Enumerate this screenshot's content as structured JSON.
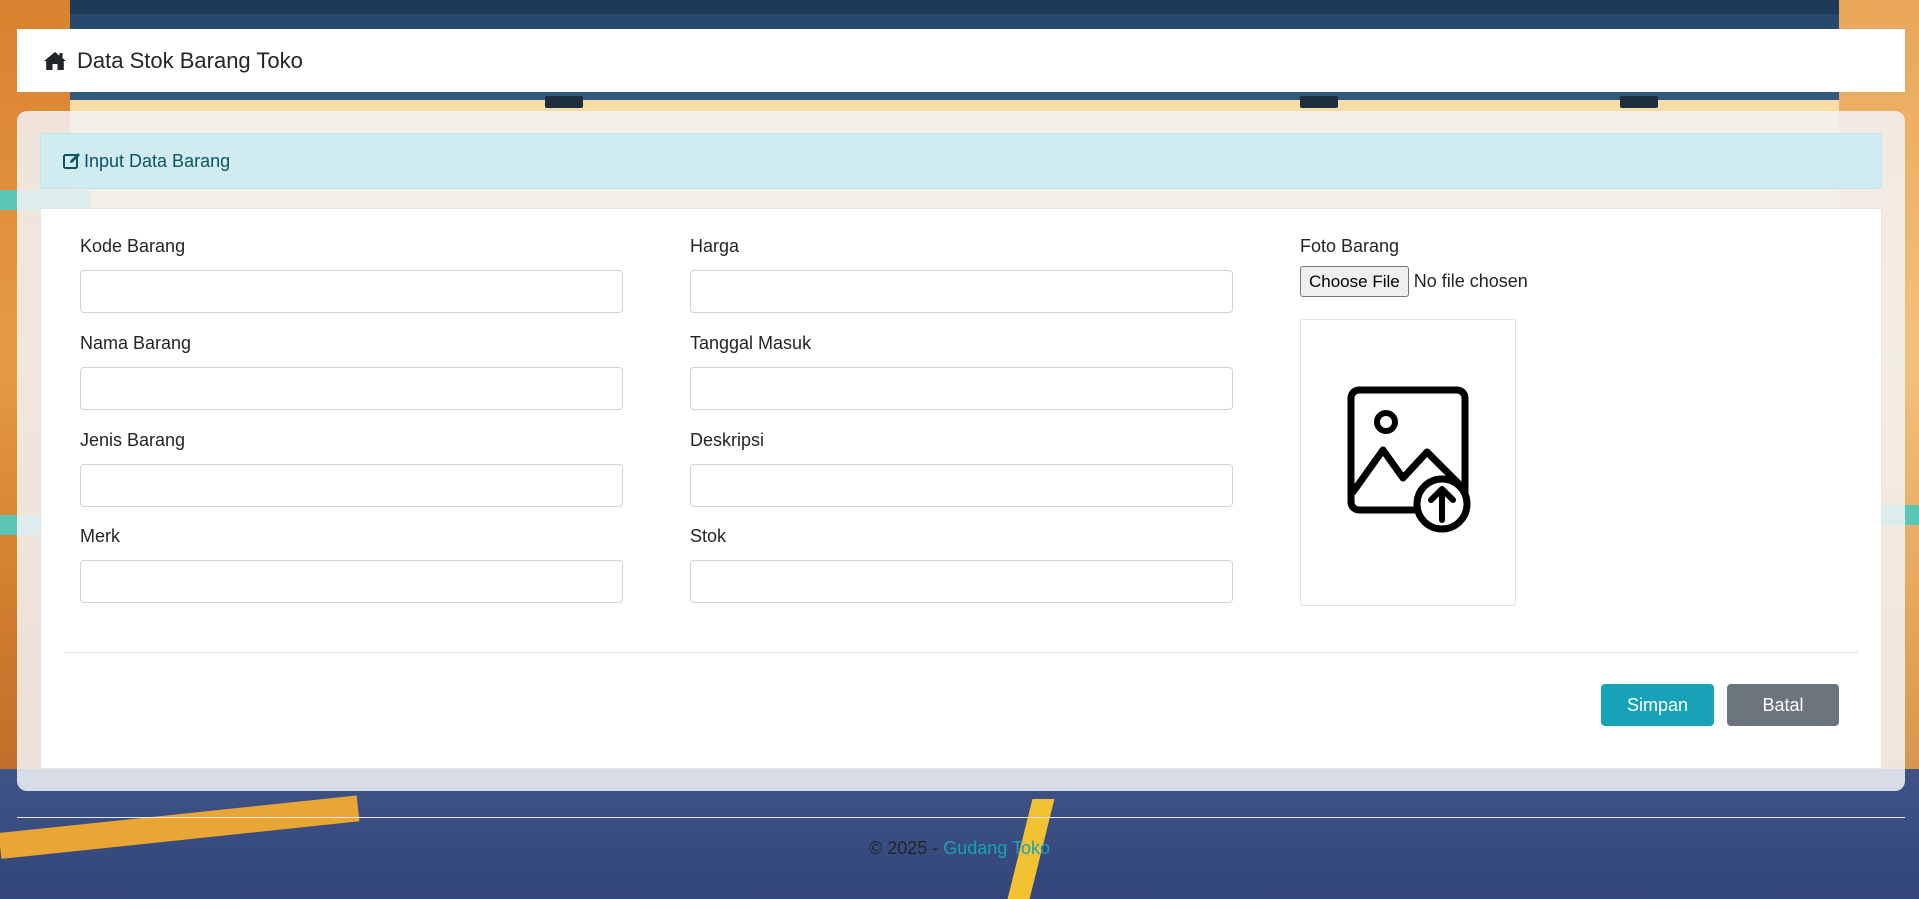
{
  "navbar": {
    "brand": "Data Stok Barang Toko",
    "icon": "home-icon"
  },
  "alert": {
    "title": "Input Data Barang",
    "icon": "edit-icon"
  },
  "form": {
    "fields": [
      {
        "label": "Kode Barang",
        "value": ""
      },
      {
        "label": "Nama Barang",
        "value": ""
      },
      {
        "label": "Jenis Barang",
        "value": ""
      },
      {
        "label": "Merk",
        "value": ""
      },
      {
        "label": "Harga",
        "value": ""
      },
      {
        "label": "Tanggal Masuk",
        "value": ""
      },
      {
        "label": "Deskripsi",
        "value": ""
      },
      {
        "label": "Stok",
        "value": ""
      }
    ],
    "photo": {
      "label": "Foto Barang",
      "button": "Choose File",
      "status": "No file chosen",
      "preview_icon": "image-upload-icon"
    },
    "buttons": {
      "save": "Simpan",
      "cancel": "Batal"
    }
  },
  "footer": {
    "prefix": "© 2025 - ",
    "link": "Gudang Toko"
  },
  "colors": {
    "primary": "#17a2b8",
    "secondary": "#6c757d",
    "alert_bg": "#d1ecf1",
    "alert_text": "#0c5460"
  }
}
